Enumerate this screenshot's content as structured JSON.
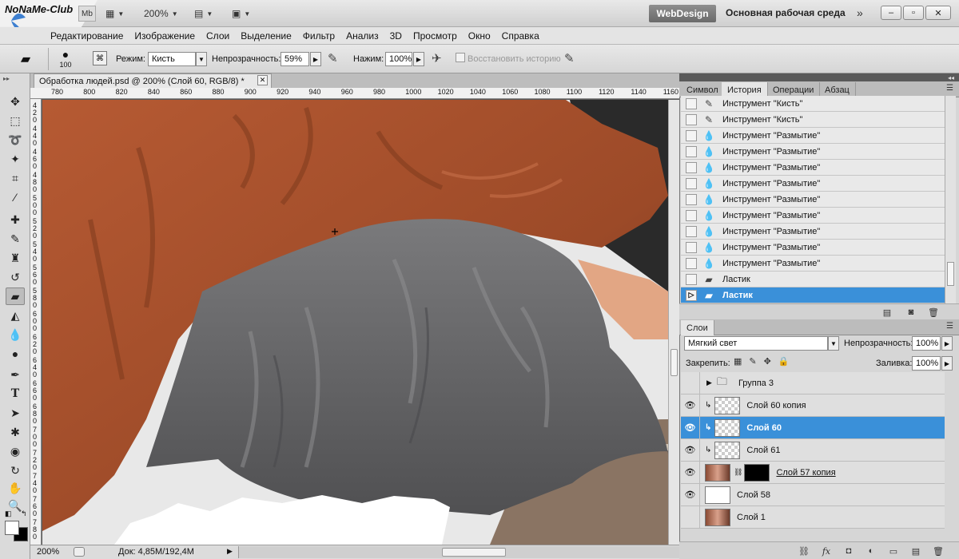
{
  "app": {
    "zoom": "200%",
    "workspace_active": "WebDesign",
    "workspace_main": "Основная рабочая среда",
    "more_glyph": "»",
    "mb_label": "Mb"
  },
  "logo": {
    "text": "NoNaMe-Club"
  },
  "window_controls": {
    "minimize": "–",
    "restore": "▫",
    "close": "✕"
  },
  "menu": [
    "Редактирование",
    "Изображение",
    "Слои",
    "Выделение",
    "Фильтр",
    "Анализ",
    "3D",
    "Просмотр",
    "Окно",
    "Справка"
  ],
  "options": {
    "brush_size": "100",
    "mode_label": "Режим:",
    "mode_value": "Кисть",
    "opacity_label": "Непрозрачность:",
    "opacity_value": "59%",
    "flow_label": "Нажим:",
    "flow_value": "100%",
    "restore_history": "Восстановить историю"
  },
  "document": {
    "tab_title": "Обработка людей.psd @ 200% (Слой 60, RGB/8) *",
    "ruler_top": [
      "780",
      "800",
      "820",
      "840",
      "860",
      "880",
      "900",
      "920",
      "940",
      "960",
      "980",
      "1000",
      "1020",
      "1040",
      "1060",
      "1080",
      "1100",
      "1120",
      "1140",
      "1160"
    ],
    "ruler_left": [
      "4\n2\n0",
      "4\n4\n0",
      "4\n6\n0",
      "4\n8\n0",
      "5\n0\n0",
      "5\n2\n0",
      "5\n4\n0",
      "5\n6\n0",
      "5\n8\n0",
      "6\n0\n0",
      "6\n2\n0",
      "6\n4\n0",
      "6\n6\n0",
      "6\n8\n0",
      "7\n0\n0",
      "7\n2\n0",
      "7\n4\n0",
      "7\n6\n0",
      "7\n8\n0"
    ],
    "status_zoom": "200%",
    "status_doc": "Док: 4,85M/192,4M"
  },
  "history_panel": {
    "tabs": [
      "Символ",
      "История",
      "Операции",
      "Абзац"
    ],
    "active_tab": 1,
    "items": [
      {
        "label": "Инструмент \"Кисть\"",
        "icon": "brush-icon"
      },
      {
        "label": "Инструмент \"Кисть\"",
        "icon": "brush-icon"
      },
      {
        "label": "Инструмент \"Размытие\"",
        "icon": "blur-drop-icon"
      },
      {
        "label": "Инструмент \"Размытие\"",
        "icon": "blur-drop-icon"
      },
      {
        "label": "Инструмент \"Размытие\"",
        "icon": "blur-drop-icon"
      },
      {
        "label": "Инструмент \"Размытие\"",
        "icon": "blur-drop-icon"
      },
      {
        "label": "Инструмент \"Размытие\"",
        "icon": "blur-drop-icon"
      },
      {
        "label": "Инструмент \"Размытие\"",
        "icon": "blur-drop-icon"
      },
      {
        "label": "Инструмент \"Размытие\"",
        "icon": "blur-drop-icon"
      },
      {
        "label": "Инструмент \"Размытие\"",
        "icon": "blur-drop-icon"
      },
      {
        "label": "Инструмент \"Размытие\"",
        "icon": "blur-drop-icon"
      },
      {
        "label": "Ластик",
        "icon": "eraser-icon"
      },
      {
        "label": "Ластик",
        "icon": "eraser-icon",
        "selected": true
      }
    ]
  },
  "layers_panel": {
    "tab": "Слои",
    "blend_mode": "Мягкий свет",
    "opacity_label": "Непрозрачность:",
    "opacity_value": "100%",
    "lock_label": "Закрепить:",
    "fill_label": "Заливка:",
    "fill_value": "100%",
    "layers": [
      {
        "name": "Группа 3",
        "type": "group",
        "visible": false
      },
      {
        "name": "Слой 60 копия",
        "type": "clipped",
        "visible": true
      },
      {
        "name": "Слой 60",
        "type": "clipped",
        "visible": true,
        "selected": true
      },
      {
        "name": "Слой 61",
        "type": "clipped",
        "visible": true
      },
      {
        "name": "Слой 57 копия",
        "type": "masked",
        "visible": true
      },
      {
        "name": "Слой 58",
        "type": "white",
        "visible": true
      },
      {
        "name": "Слой 1",
        "type": "photo",
        "visible": false
      }
    ]
  },
  "colors": {
    "selection": "#3a90d9",
    "shirt": "#a9532f",
    "cloth": "#6a6a6c",
    "skin": "#e2a684"
  }
}
